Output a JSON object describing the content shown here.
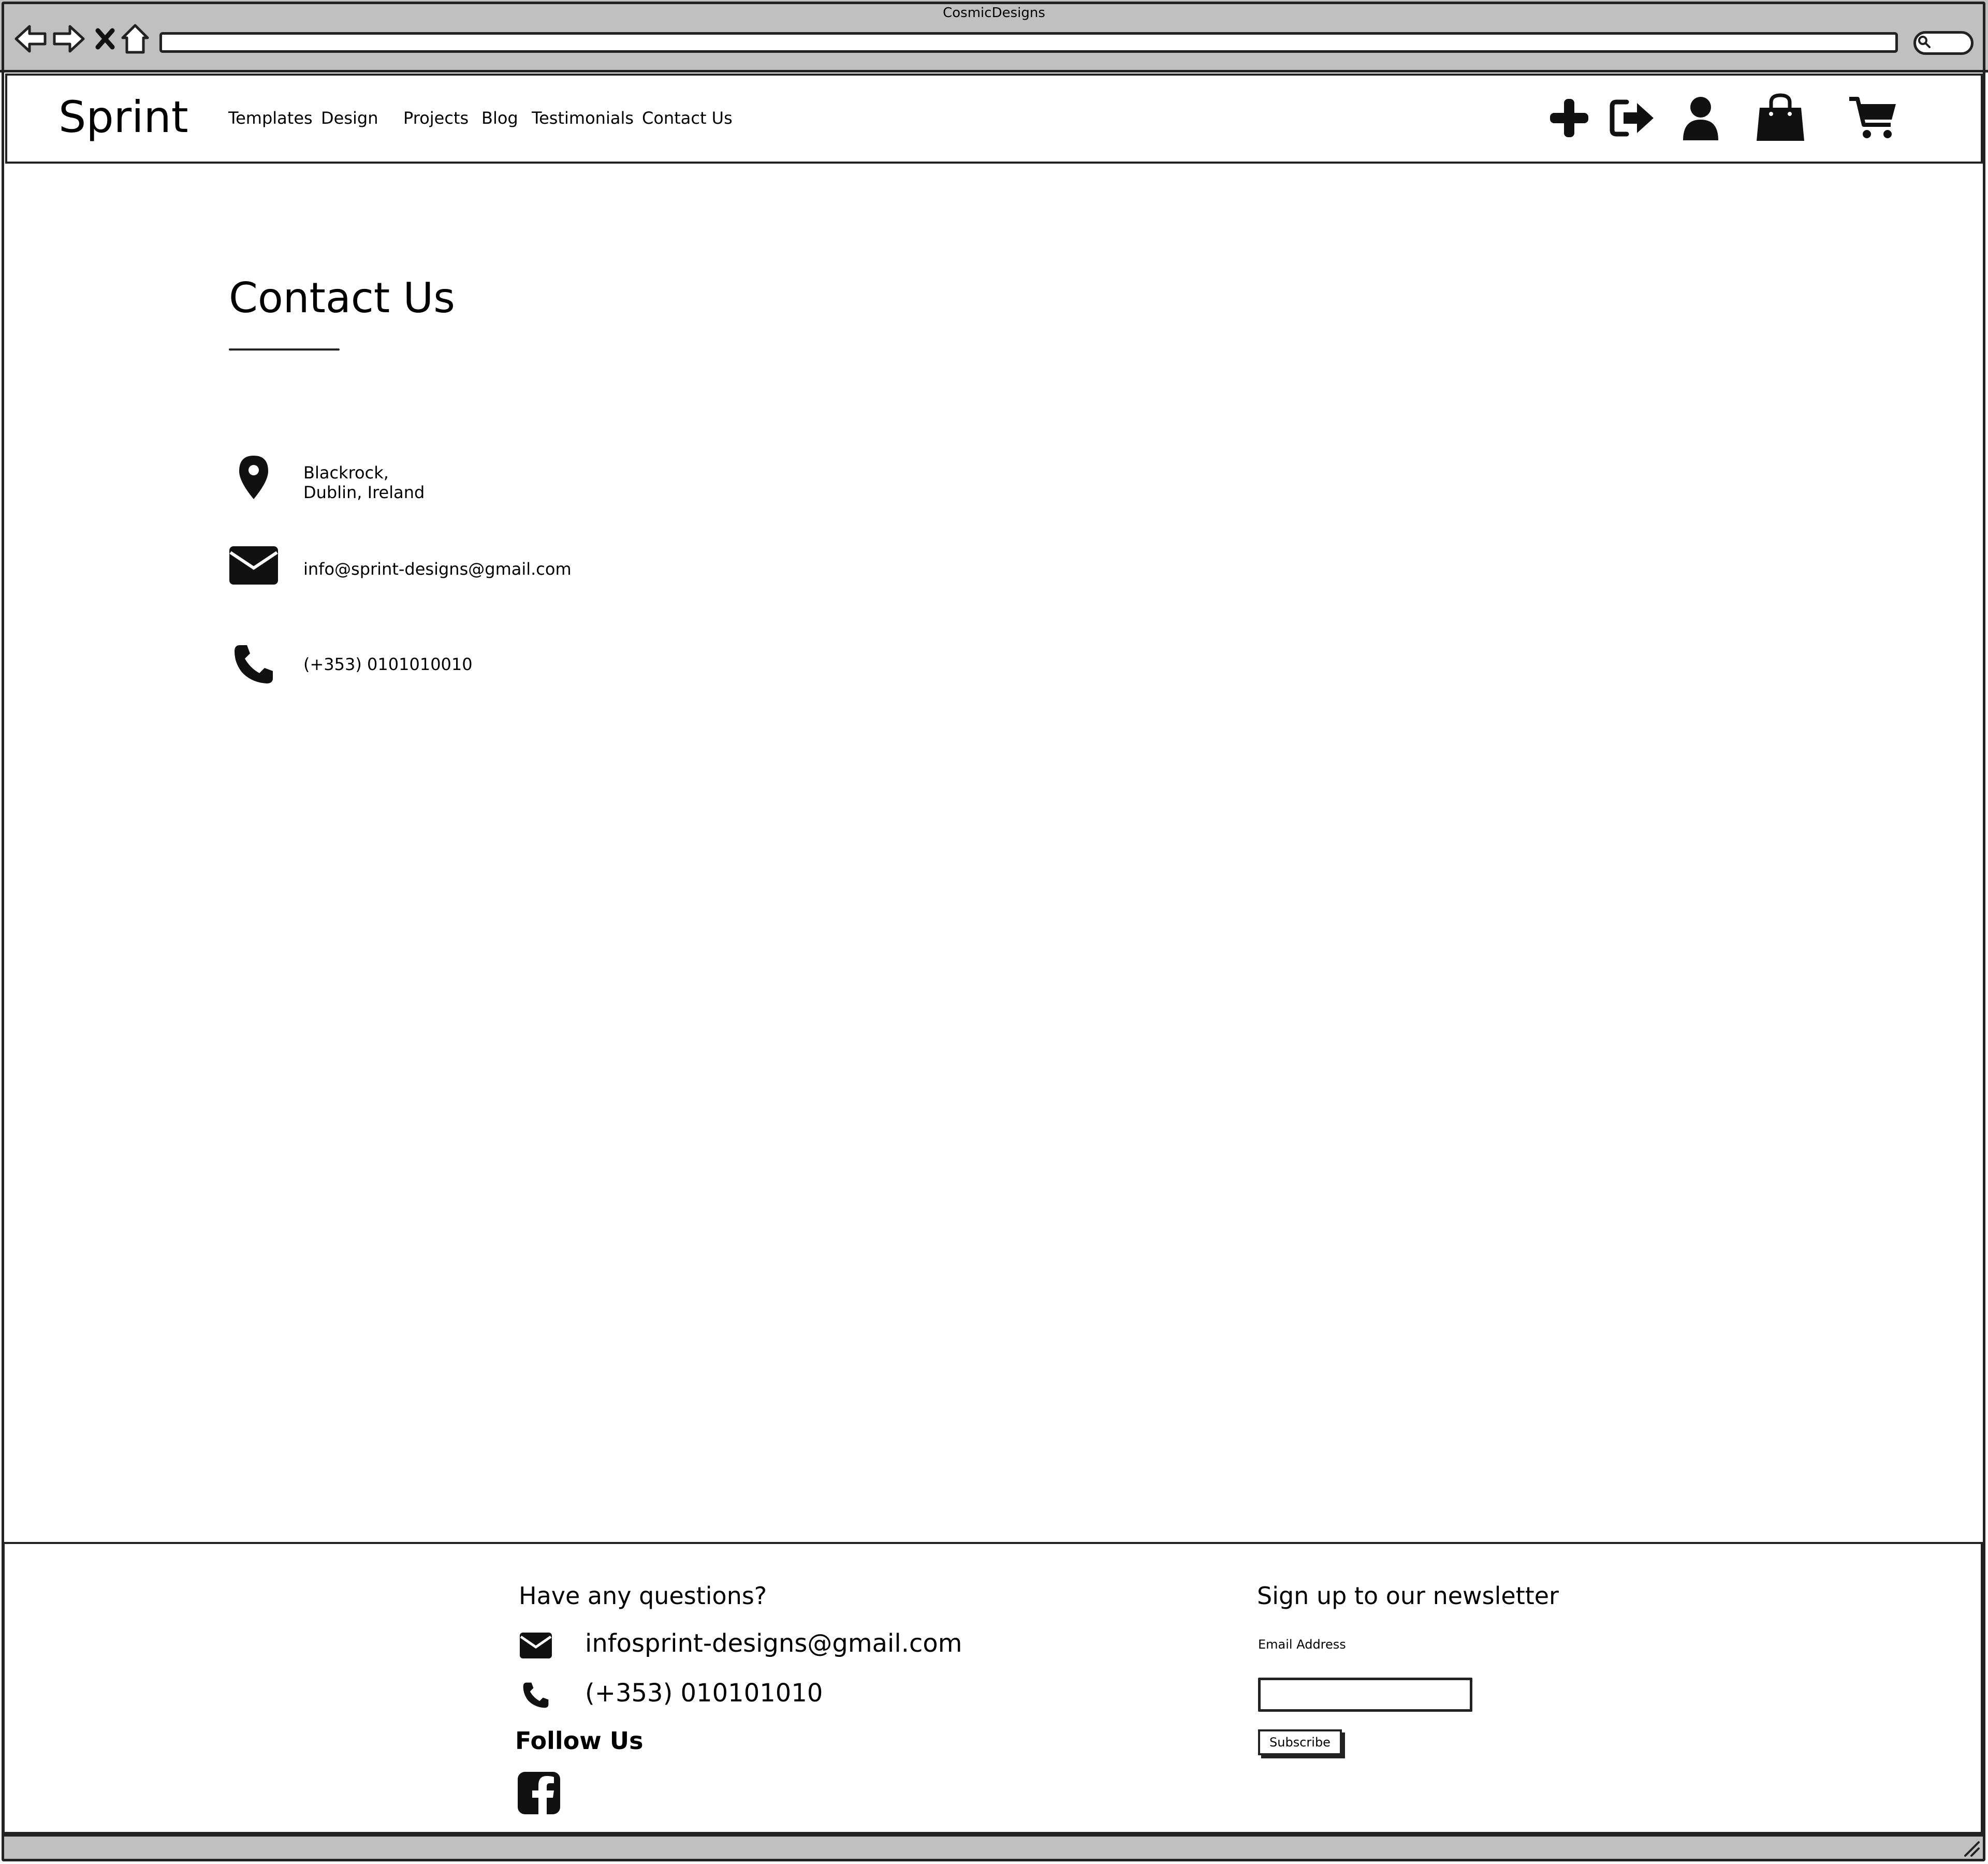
{
  "window": {
    "title": "CosmicDesigns"
  },
  "browser": {
    "url": "",
    "icons": [
      "back-arrow-icon",
      "forward-arrow-icon",
      "stop-icon",
      "home-icon",
      "search-icon"
    ]
  },
  "header": {
    "logo": "Sprint",
    "nav": [
      "Templates",
      "Design",
      "Projects",
      "Blog",
      "Testimonials",
      "Contact Us"
    ],
    "icons": [
      "plus-icon",
      "sign-in-icon",
      "user-icon",
      "shopping-bag-icon",
      "cart-icon"
    ]
  },
  "main": {
    "title": "Contact Us",
    "address_line1": "Blackrock,",
    "address_line2": "Dublin, Ireland",
    "email": "info@sprint-designs@gmail.com",
    "phone": "(+353) 0101010010"
  },
  "footer": {
    "questions_heading": "Have any questions?",
    "email": "infosprint-designs@gmail.com",
    "phone": "(+353) 010101010",
    "follow_heading": "Follow Us",
    "newsletter_heading": "Sign up to our newsletter",
    "email_label": "Email Address",
    "email_value": "",
    "subscribe_label": "Subscribe"
  },
  "colors": {
    "ink": "#000000",
    "chrome": "#c0c0c0",
    "background": "#ffffff"
  }
}
